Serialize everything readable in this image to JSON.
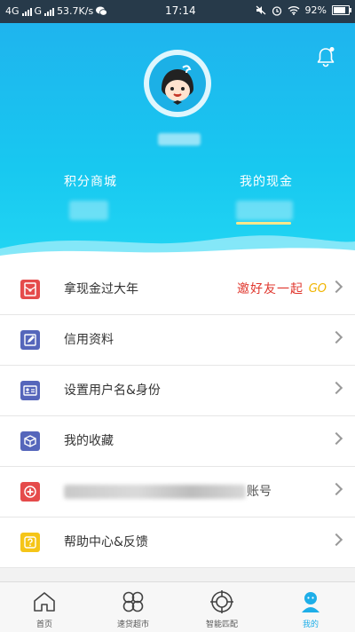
{
  "status_bar": {
    "network_1": "4G",
    "network_2": "G",
    "speed": "53.7K/s",
    "time": "17:14",
    "battery": "92%"
  },
  "header": {
    "bell_icon": "bell-icon",
    "points_label": "积分商城",
    "cash_label": "我的现金",
    "accent_color": "#1fb4ee"
  },
  "menu": {
    "items": [
      {
        "label": "拿现金过大年",
        "icon": "red-envelope-icon",
        "color": "#e54b4b"
      },
      {
        "label": "信用资料",
        "icon": "edit-icon",
        "color": "#5566bb"
      },
      {
        "label": "设置用户名&身份",
        "icon": "id-card-icon",
        "color": "#5566bb"
      },
      {
        "label": "我的收藏",
        "icon": "box-icon",
        "color": "#5566bb"
      },
      {
        "label": "",
        "icon": "plus-circle-icon",
        "color": "#e54b4b"
      },
      {
        "label": "帮助中心&反馈",
        "icon": "question-icon",
        "color": "#f5c518"
      }
    ],
    "promo_text": "邀好友一起",
    "promo_go": "GO",
    "row5_suffix": "账号"
  },
  "bottom_nav": {
    "tabs": [
      {
        "label": "首页",
        "icon": "home-icon"
      },
      {
        "label": "速贷超市",
        "icon": "clover-icon"
      },
      {
        "label": "智能匹配",
        "icon": "target-icon"
      },
      {
        "label": "我的",
        "icon": "profile-icon"
      }
    ]
  }
}
